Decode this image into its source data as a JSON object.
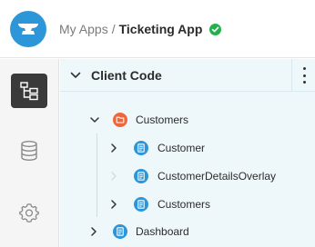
{
  "header": {
    "breadcrumb_parent": "My Apps",
    "breadcrumb_separator": "/",
    "breadcrumb_current": "Ticketing App",
    "status": "published-check"
  },
  "rail": {
    "items": [
      {
        "name": "client-code",
        "icon": "hierarchy-icon",
        "active": true
      },
      {
        "name": "database",
        "icon": "database-icon",
        "active": false
      },
      {
        "name": "settings",
        "icon": "gear-icon",
        "active": false
      }
    ]
  },
  "panel": {
    "title": "Client Code",
    "tree": {
      "folder": {
        "label": "Customers",
        "expanded": true
      },
      "children": [
        {
          "label": "Customer",
          "expandable": true
        },
        {
          "label": "CustomerDetailsOverlay",
          "expandable": false
        },
        {
          "label": "Customers",
          "expandable": true
        }
      ],
      "sibling": {
        "label": "Dashboard",
        "expandable": true
      }
    }
  },
  "colors": {
    "accent": "#2d96d8",
    "folder": "#f0663a",
    "file": "#2d96d8",
    "success": "#23b14d",
    "panel_bg": "#eef8fb",
    "rail_active": "#3a3a3a"
  }
}
